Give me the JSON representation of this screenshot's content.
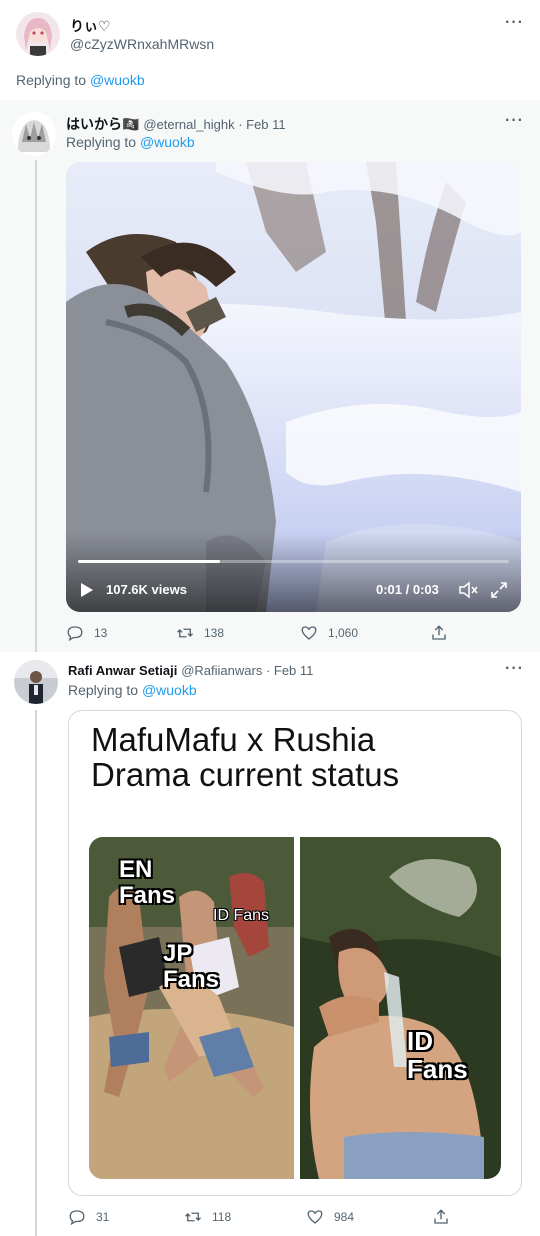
{
  "main_tweet": {
    "display_name": "りぃ♡",
    "handle": "@cZyzWRnxahMRwsn",
    "replying_prefix": "Replying to ",
    "replying_to": "@wuokb"
  },
  "reply1": {
    "display_name": "はいから🏴‍☠️",
    "handle_date": "@eternal_highk · Feb 11",
    "replying_prefix": "Replying to ",
    "replying_to": "@wuokb",
    "video": {
      "views": "107.6K views",
      "time": "0:01 / 0:03",
      "progress": 0.33
    },
    "stats": {
      "replies": "13",
      "retweets": "138",
      "likes": "1,060"
    }
  },
  "reply2": {
    "display_name": "Rafi Anwar Setiaji",
    "handle_date": "@Rafiianwars · Feb 11",
    "replying_prefix": "Replying to ",
    "replying_to": "@wuokb",
    "meme": {
      "title_line1": "MafuMafu x Rushia",
      "title_line2": "Drama current status",
      "label_en": "EN\nFans",
      "label_id_small": "ID Fans",
      "label_jp": "JP\nFans",
      "label_id_big": "ID\nFans"
    },
    "stats": {
      "replies": "31",
      "retweets": "118",
      "likes": "984"
    }
  },
  "icons": {
    "more": "more-icon",
    "reply": "reply-icon",
    "retweet": "retweet-icon",
    "like": "heart-icon",
    "share": "share-icon",
    "play": "play-icon",
    "mute": "mute-icon",
    "fullscreen": "fullscreen-icon"
  },
  "colors": {
    "accent": "#1d9bf0",
    "secondary_text": "#536471"
  }
}
